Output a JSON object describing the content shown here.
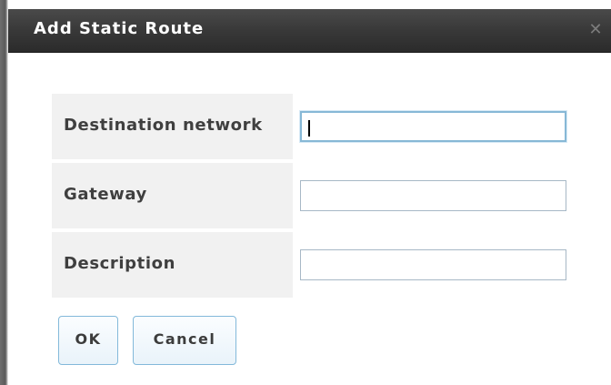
{
  "dialog": {
    "title": "Add Static Route",
    "close_glyph": "✕",
    "close_icon": "close-icon"
  },
  "form": {
    "fields": [
      {
        "label": "Destination network",
        "value": "",
        "placeholder": "",
        "focused": true
      },
      {
        "label": "Gateway",
        "value": "",
        "placeholder": "",
        "focused": false
      },
      {
        "label": "Description",
        "value": "",
        "placeholder": "",
        "focused": false
      }
    ]
  },
  "buttons": {
    "ok_label": "OK",
    "cancel_label": "Cancel"
  },
  "colors": {
    "title_bg": "#3a3a3a",
    "label_bg": "#f1f1f1",
    "button_border": "#83b9da"
  }
}
